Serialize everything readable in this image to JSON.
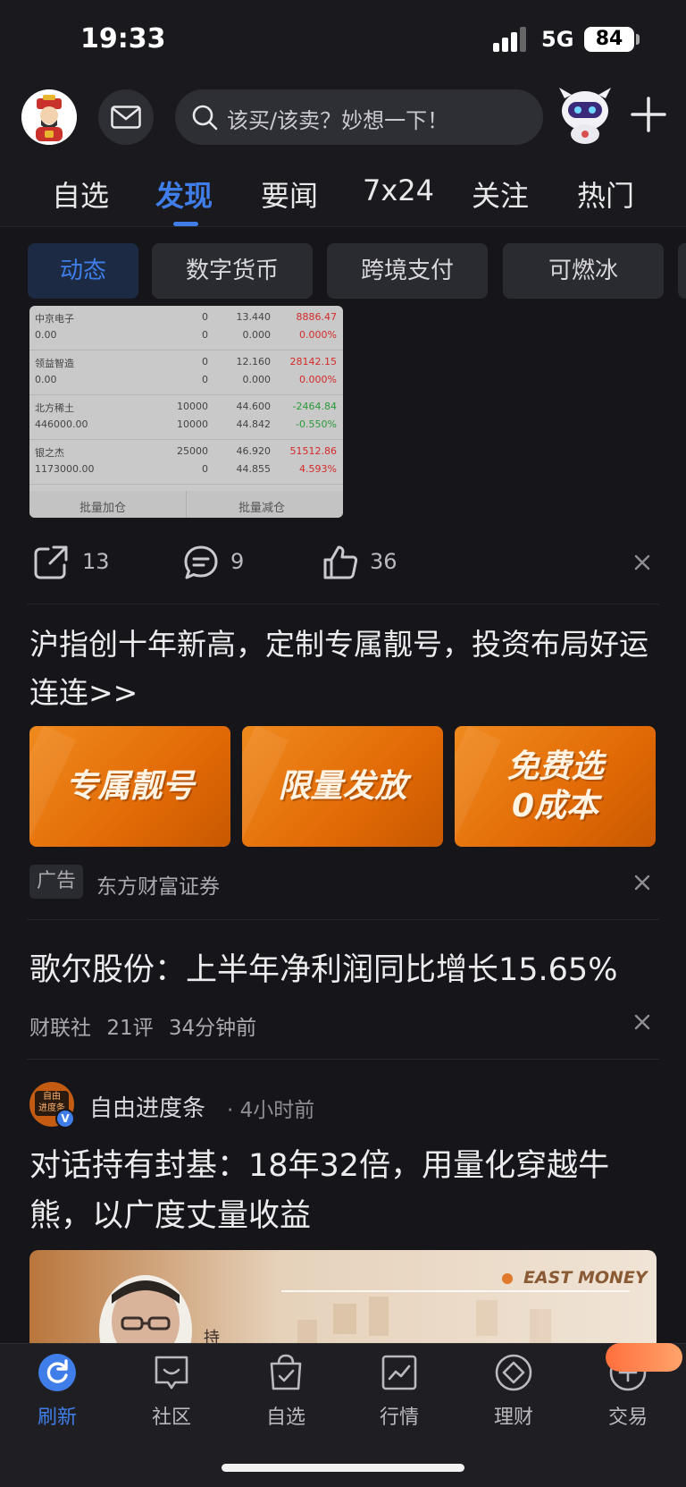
{
  "status_bar": {
    "time": "19:33",
    "network": "5G",
    "battery": "84"
  },
  "header": {
    "search_placeholder": "该买/该卖？妙想一下！"
  },
  "tabs": [
    {
      "label": "自选"
    },
    {
      "label": "发现",
      "active": true
    },
    {
      "label": "要闻"
    },
    {
      "label": "7x24"
    },
    {
      "label": "关注"
    },
    {
      "label": "热门"
    }
  ],
  "chips": [
    {
      "label": "动态",
      "active": true
    },
    {
      "label": "数字货币"
    },
    {
      "label": "跨境支付"
    },
    {
      "label": "可燃冰"
    }
  ],
  "portfolio": {
    "rows": [
      {
        "name": "中京电子",
        "q1": "0",
        "p1": "13.440",
        "v1": "8886.47",
        "val": "0.00",
        "q2": "0",
        "p2": "0.000",
        "v2": "0.000%"
      },
      {
        "name": "领益智造",
        "q1": "0",
        "p1": "12.160",
        "v1": "28142.15",
        "val": "0.00",
        "q2": "0",
        "p2": "0.000",
        "v2": "0.000%"
      },
      {
        "name": "北方稀土",
        "q1": "10000",
        "p1": "44.600",
        "v1": "-2464.84",
        "val": "446000.00",
        "q2": "10000",
        "p2": "44.842",
        "v2": "-0.550%"
      },
      {
        "name": "银之杰",
        "q1": "25000",
        "p1": "46.920",
        "v1": "51512.86",
        "val": "1173000.00",
        "q2": "0",
        "p2": "44.855",
        "v2": "4.593%"
      }
    ],
    "btn_add": "批量加仓",
    "btn_reduce": "批量减仓"
  },
  "post_actions": {
    "share_count": "13",
    "comment_count": "9",
    "like_count": "36"
  },
  "ad": {
    "title": "沪指创十年新高，定制专属靓号，投资布局好运连连>>",
    "banners": [
      "专属靓号",
      "限量发放",
      "免费选\n0成本"
    ],
    "tag": "广告",
    "source": "东方财富证券"
  },
  "news": {
    "title": "歌尔股份：上半年净利润同比增长15.65%",
    "source": "财联社",
    "comments": "21评",
    "time": "34分钟前"
  },
  "post": {
    "avatar_text": "自由\n进度条",
    "author": "自由进度条",
    "time": "· 4小时前",
    "title": "对话持有封基：18年32倍，用量化穿越牛熊，以广度丈量收益",
    "image_brand": "EAST MONEY",
    "image_caption": "持"
  },
  "bottom_nav": [
    {
      "label": "刷新",
      "icon": "refresh-icon",
      "active": true
    },
    {
      "label": "社区",
      "icon": "community-icon"
    },
    {
      "label": "自选",
      "icon": "watchlist-icon"
    },
    {
      "label": "行情",
      "icon": "market-icon"
    },
    {
      "label": "理财",
      "icon": "wealth-icon"
    },
    {
      "label": "交易",
      "icon": "trade-icon"
    }
  ],
  "colors": {
    "accent": "#3f7ee8",
    "background": "#16161a",
    "ad_orange": "#e26a06"
  }
}
